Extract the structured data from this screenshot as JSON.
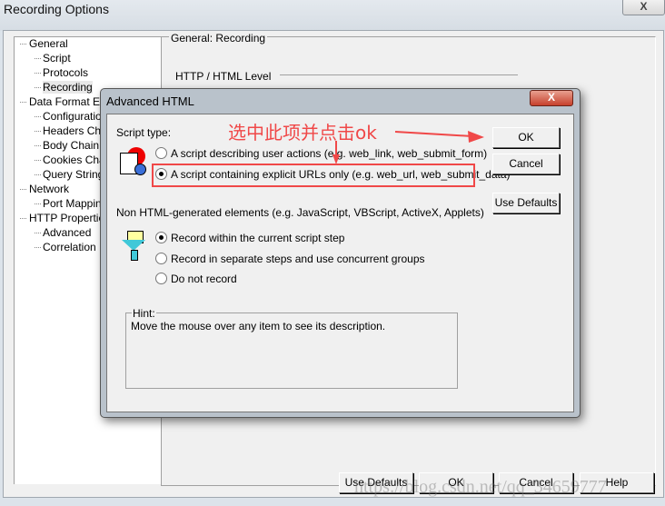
{
  "window": {
    "title": "Recording Options",
    "close": "X"
  },
  "tree": [
    {
      "label": "General",
      "level": 0
    },
    {
      "label": "Script",
      "level": 1
    },
    {
      "label": "Protocols",
      "level": 1
    },
    {
      "label": "Recording",
      "level": 1
    },
    {
      "label": "Data Format Ext",
      "level": 0
    },
    {
      "label": "Configuration",
      "level": 1
    },
    {
      "label": "Headers Cha",
      "level": 1
    },
    {
      "label": "Body Chain",
      "level": 1
    },
    {
      "label": "Cookies Chai",
      "level": 1
    },
    {
      "label": "Query String",
      "level": 1
    },
    {
      "label": "Network",
      "level": 0
    },
    {
      "label": "Port Mapping",
      "level": 1
    },
    {
      "label": "HTTP Properties",
      "level": 0
    },
    {
      "label": "Advanced",
      "level": 1
    },
    {
      "label": "Correlation",
      "level": 1
    }
  ],
  "panel": {
    "group": "General: Recording",
    "section": "HTTP / HTML Level"
  },
  "footer": {
    "use_defaults": "Use Defaults",
    "ok": "OK",
    "cancel": "Cancel",
    "help": "Help"
  },
  "watermark": "https://blog.csdn.net/qq_34659777",
  "dialog": {
    "title": "Advanced HTML",
    "close": "X",
    "script_type_label": "Script type:",
    "script_options": [
      {
        "label": "A script describing user actions (e.g. web_link, web_submit_form)",
        "selected": false
      },
      {
        "label": "A script containing explicit URLs only (e.g. web_url, web_submit_data)",
        "selected": true
      }
    ],
    "non_html_label": "Non HTML-generated elements (e.g. JavaScript, VBScript, ActiveX, Applets)",
    "non_html_options": [
      {
        "label": "Record within the current script step",
        "selected": true
      },
      {
        "label": "Record in separate steps and use concurrent groups",
        "selected": false
      },
      {
        "label": "Do not record",
        "selected": false
      }
    ],
    "hint_label": "Hint:",
    "hint_text": "Move the mouse over any item to see its description.",
    "ok": "OK",
    "cancel": "Cancel",
    "use_defaults": "Use Defaults"
  },
  "annotation": {
    "text": "选中此项并点击ok",
    "color": "#f04848"
  }
}
